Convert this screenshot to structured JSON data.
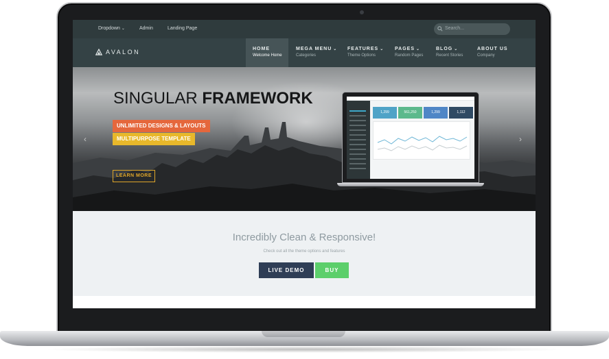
{
  "topbar": {
    "links": [
      {
        "label": "Dropdown",
        "has_caret": true
      },
      {
        "label": "Admin",
        "has_caret": false
      },
      {
        "label": "Landing Page",
        "has_caret": false
      }
    ],
    "search_placeholder": "Search..."
  },
  "navbar": {
    "brand": "AVALON",
    "items": [
      {
        "label": "HOME",
        "sub": "Welcome Home",
        "active": true,
        "has_caret": false
      },
      {
        "label": "MEGA MENU",
        "sub": "Categories",
        "active": false,
        "has_caret": true
      },
      {
        "label": "FEATURES",
        "sub": "Theme Options",
        "active": false,
        "has_caret": true
      },
      {
        "label": "PAGES",
        "sub": "Random Pages",
        "active": false,
        "has_caret": true
      },
      {
        "label": "BLOG",
        "sub": "Recent Stories",
        "active": false,
        "has_caret": true
      },
      {
        "label": "ABOUT US",
        "sub": "Company",
        "active": false,
        "has_caret": false
      }
    ]
  },
  "hero": {
    "title_light": "SINGULAR ",
    "title_bold": "FRAMEWORK",
    "badge_primary": "UNLIMITED DESIGNS & LAYOUTS",
    "badge_secondary": "MULTIPURPOSE TEMPLATE",
    "cta_label": "LEARN MORE",
    "prev_arrow": "‹",
    "next_arrow": "›",
    "colors": {
      "badge_primary": "#e5673c",
      "badge_secondary": "#e8b82b",
      "cta": "#e0a72a"
    }
  },
  "preview": {
    "tiles": [
      {
        "value": "1,299",
        "color": "#4fa3c7"
      },
      {
        "value": "561,250",
        "color": "#5cb98c"
      },
      {
        "value": "1,299",
        "color": "#4f86c6"
      },
      {
        "value": "1,112",
        "color": "#2f4a63"
      }
    ]
  },
  "section": {
    "title": "Incredibly Clean & Responsive!",
    "subtitle": "Check out all the theme options and features",
    "demo_label": "LIVE DEMO",
    "buy_label": "BUY",
    "colors": {
      "demo": "#2f3e56",
      "buy": "#5ccf6b"
    }
  },
  "icons": {
    "search": "search-icon",
    "brand": "triangle-logo-icon",
    "caret": "chevron-down-icon"
  }
}
